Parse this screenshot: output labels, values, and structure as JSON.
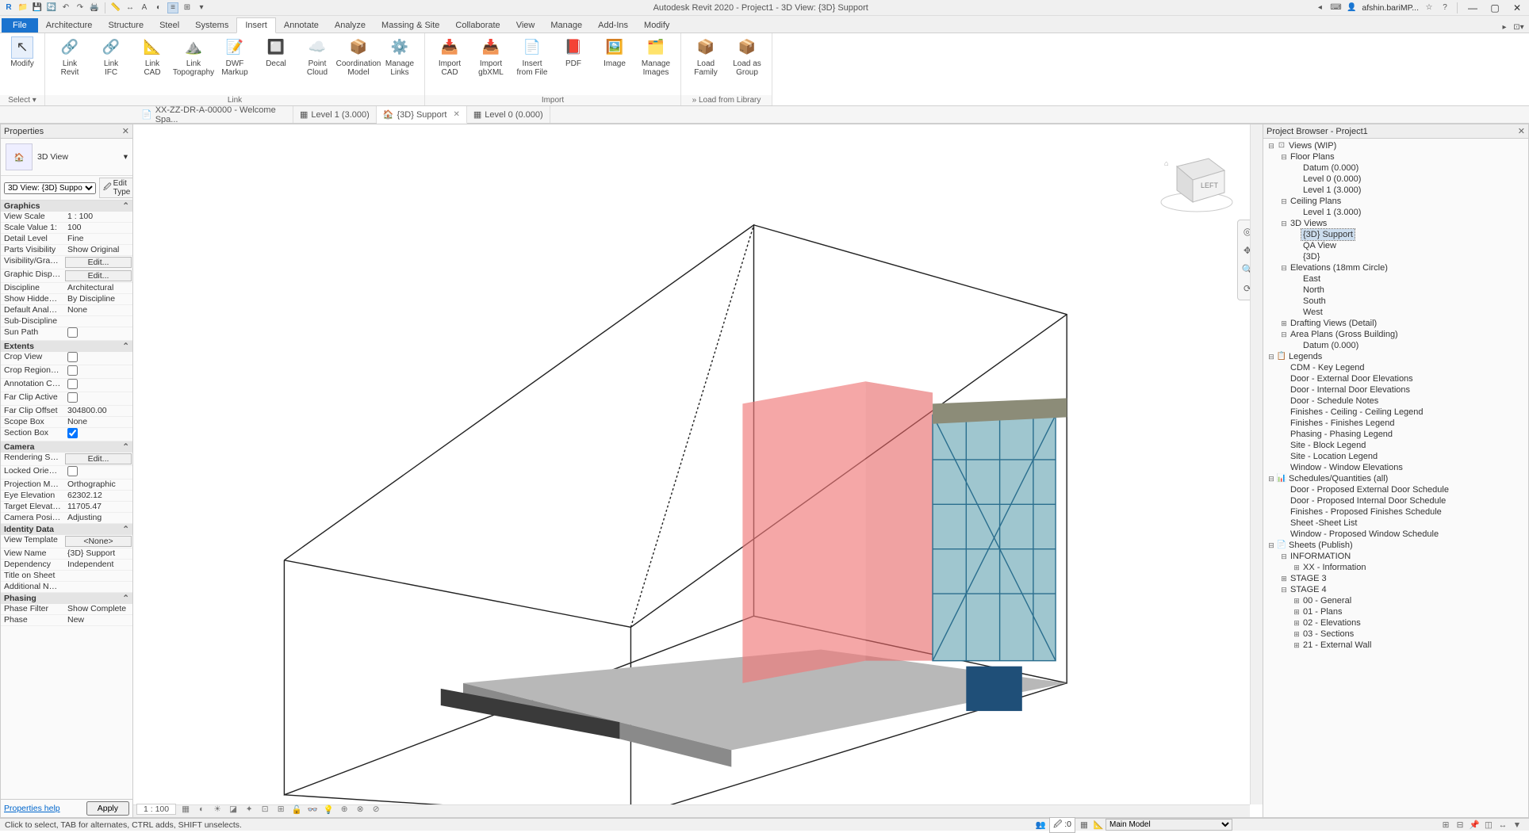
{
  "title": "Autodesk Revit 2020 - Project1 - 3D View: {3D} Support",
  "user_label": "afshin.bariMP...",
  "search_placeholder": "",
  "ribbon_tabs": [
    "Architecture",
    "Structure",
    "Steel",
    "Systems",
    "Insert",
    "Annotate",
    "Analyze",
    "Massing & Site",
    "Collaborate",
    "View",
    "Manage",
    "Add-Ins",
    "Modify"
  ],
  "ribbon_active": "Insert",
  "file_tab": "File",
  "modify_btn": "Modify",
  "select_group": "Select ▾",
  "ribbon": {
    "link": {
      "label": "Link",
      "buttons": [
        {
          "n": "Link\nRevit",
          "ic": "🔗"
        },
        {
          "n": "Link\nIFC",
          "ic": "🔗"
        },
        {
          "n": "Link\nCAD",
          "ic": "📐"
        },
        {
          "n": "Link\nTopography",
          "ic": "⛰️"
        },
        {
          "n": "DWF\nMarkup",
          "ic": "📝"
        },
        {
          "n": "Decal",
          "ic": "🔲"
        },
        {
          "n": "Point\nCloud",
          "ic": "☁️"
        },
        {
          "n": "Coordination\nModel",
          "ic": "📦"
        },
        {
          "n": "Manage\nLinks",
          "ic": "⚙️"
        }
      ]
    },
    "import": {
      "label": "Import",
      "buttons": [
        {
          "n": "Import\nCAD",
          "ic": "📥"
        },
        {
          "n": "Import\ngbXML",
          "ic": "📥"
        },
        {
          "n": "Insert\nfrom File",
          "ic": "📄"
        },
        {
          "n": "PDF",
          "ic": "📕"
        },
        {
          "n": "Image",
          "ic": "🖼️"
        },
        {
          "n": "Manage\nImages",
          "ic": "🗂️"
        }
      ]
    },
    "load": {
      "label": "Load from Library",
      "buttons": [
        {
          "n": "Load\nFamily",
          "ic": "📦"
        },
        {
          "n": "Load as\nGroup",
          "ic": "📦"
        }
      ]
    }
  },
  "doctabs": [
    {
      "label": "XX-ZZ-DR-A-00000 - Welcome Spa...",
      "active": false,
      "ic": "📄",
      "close": false
    },
    {
      "label": "Level 1 (3.000)",
      "active": false,
      "ic": "▦",
      "close": false
    },
    {
      "label": "{3D} Support",
      "active": true,
      "ic": "🏠",
      "close": true
    },
    {
      "label": "Level 0 (0.000)",
      "active": false,
      "ic": "▦",
      "close": false
    }
  ],
  "properties": {
    "title": "Properties",
    "type_label": "3D View",
    "instance_dd": "3D View: {3D} Suppo",
    "edit_type": "Edit Type",
    "groups": [
      {
        "name": "Graphics",
        "rows": [
          {
            "n": "View Scale",
            "v": "1 : 100"
          },
          {
            "n": "Scale Value    1:",
            "v": "100"
          },
          {
            "n": "Detail Level",
            "v": "Fine"
          },
          {
            "n": "Parts Visibility",
            "v": "Show Original"
          },
          {
            "n": "Visibility/Graphi...",
            "v": "Edit...",
            "btn": true
          },
          {
            "n": "Graphic Display...",
            "v": "Edit...",
            "btn": true
          },
          {
            "n": "Discipline",
            "v": "Architectural"
          },
          {
            "n": "Show Hidden Li...",
            "v": "By Discipline"
          },
          {
            "n": "Default Analysis...",
            "v": "None"
          },
          {
            "n": "Sub-Discipline",
            "v": ""
          },
          {
            "n": "Sun Path",
            "v": "",
            "chk": false
          }
        ]
      },
      {
        "name": "Extents",
        "rows": [
          {
            "n": "Crop View",
            "v": "",
            "chk": false
          },
          {
            "n": "Crop Region Vis...",
            "v": "",
            "chk": false
          },
          {
            "n": "Annotation Crop",
            "v": "",
            "chk": false
          },
          {
            "n": "Far Clip Active",
            "v": "",
            "chk": false
          },
          {
            "n": "Far Clip Offset",
            "v": "304800.00"
          },
          {
            "n": "Scope Box",
            "v": "None"
          },
          {
            "n": "Section Box",
            "v": "",
            "chk": true
          }
        ]
      },
      {
        "name": "Camera",
        "rows": [
          {
            "n": "Rendering Setti...",
            "v": "Edit...",
            "btn": true
          },
          {
            "n": "Locked Orientat...",
            "v": "",
            "chk": false
          },
          {
            "n": "Projection Mode",
            "v": "Orthographic"
          },
          {
            "n": "Eye Elevation",
            "v": "62302.12"
          },
          {
            "n": "Target Elevation",
            "v": "11705.47"
          },
          {
            "n": "Camera Position",
            "v": "Adjusting"
          }
        ]
      },
      {
        "name": "Identity Data",
        "rows": [
          {
            "n": "View Template",
            "v": "<None>",
            "btn": true
          },
          {
            "n": "View Name",
            "v": "{3D} Support"
          },
          {
            "n": "Dependency",
            "v": "Independent"
          },
          {
            "n": "Title on Sheet",
            "v": ""
          },
          {
            "n": "Additional Notes",
            "v": ""
          }
        ]
      },
      {
        "name": "Phasing",
        "rows": [
          {
            "n": "Phase Filter",
            "v": "Show Complete"
          },
          {
            "n": "Phase",
            "v": "New"
          }
        ]
      }
    ],
    "help": "Properties help",
    "apply": "Apply"
  },
  "viewctrl": {
    "scale": "1 : 100"
  },
  "pb": {
    "title": "Project Browser - Project1",
    "tree": [
      {
        "d": 0,
        "t": "Views (WIP)",
        "exp": "-",
        "ic": "⊡"
      },
      {
        "d": 1,
        "t": "Floor Plans",
        "exp": "-"
      },
      {
        "d": 2,
        "t": "Datum (0.000)"
      },
      {
        "d": 2,
        "t": "Level 0 (0.000)"
      },
      {
        "d": 2,
        "t": "Level 1 (3.000)"
      },
      {
        "d": 1,
        "t": "Ceiling Plans",
        "exp": "-"
      },
      {
        "d": 2,
        "t": "Level 1 (3.000)"
      },
      {
        "d": 1,
        "t": "3D Views",
        "exp": "-"
      },
      {
        "d": 2,
        "t": "{3D} Support",
        "sel": true
      },
      {
        "d": 2,
        "t": "QA View"
      },
      {
        "d": 2,
        "t": "{3D}"
      },
      {
        "d": 1,
        "t": "Elevations (18mm Circle)",
        "exp": "-"
      },
      {
        "d": 2,
        "t": "East"
      },
      {
        "d": 2,
        "t": "North"
      },
      {
        "d": 2,
        "t": "South"
      },
      {
        "d": 2,
        "t": "West"
      },
      {
        "d": 1,
        "t": "Drafting Views (Detail)",
        "exp": "+"
      },
      {
        "d": 1,
        "t": "Area Plans (Gross Building)",
        "exp": "-"
      },
      {
        "d": 2,
        "t": "Datum (0.000)"
      },
      {
        "d": 0,
        "t": "Legends",
        "exp": "-",
        "ic": "📋"
      },
      {
        "d": 1,
        "t": "CDM - Key Legend"
      },
      {
        "d": 1,
        "t": "Door - External Door Elevations"
      },
      {
        "d": 1,
        "t": "Door - Internal Door Elevations"
      },
      {
        "d": 1,
        "t": "Door - Schedule Notes"
      },
      {
        "d": 1,
        "t": "Finishes - Ceiling - Ceiling Legend"
      },
      {
        "d": 1,
        "t": "Finishes - Finishes Legend"
      },
      {
        "d": 1,
        "t": "Phasing - Phasing Legend"
      },
      {
        "d": 1,
        "t": "Site - Block Legend"
      },
      {
        "d": 1,
        "t": "Site - Location Legend"
      },
      {
        "d": 1,
        "t": "Window - Window Elevations"
      },
      {
        "d": 0,
        "t": "Schedules/Quantities (all)",
        "exp": "-",
        "ic": "📊"
      },
      {
        "d": 1,
        "t": "Door - Proposed External Door Schedule"
      },
      {
        "d": 1,
        "t": "Door - Proposed Internal Door Schedule"
      },
      {
        "d": 1,
        "t": "Finishes - Proposed Finishes Schedule"
      },
      {
        "d": 1,
        "t": "Sheet -Sheet List"
      },
      {
        "d": 1,
        "t": "Window - Proposed Window Schedule"
      },
      {
        "d": 0,
        "t": "Sheets (Publish)",
        "exp": "-",
        "ic": "📄"
      },
      {
        "d": 1,
        "t": "INFORMATION",
        "exp": "-"
      },
      {
        "d": 2,
        "t": "XX - Information",
        "exp": "+"
      },
      {
        "d": 1,
        "t": "STAGE 3",
        "exp": "+"
      },
      {
        "d": 1,
        "t": "STAGE 4",
        "exp": "-"
      },
      {
        "d": 2,
        "t": "00 - General",
        "exp": "+"
      },
      {
        "d": 2,
        "t": "01 - Plans",
        "exp": "+"
      },
      {
        "d": 2,
        "t": "02 - Elevations",
        "exp": "+"
      },
      {
        "d": 2,
        "t": "03 - Sections",
        "exp": "+"
      },
      {
        "d": 2,
        "t": "21 - External Wall",
        "exp": "+"
      }
    ]
  },
  "status": {
    "hint": "Click to select, TAB for alternates, CTRL adds, SHIFT unselects.",
    "sel": "0",
    "model": "Main Model"
  },
  "viewcube": {
    "face": "LEFT"
  }
}
